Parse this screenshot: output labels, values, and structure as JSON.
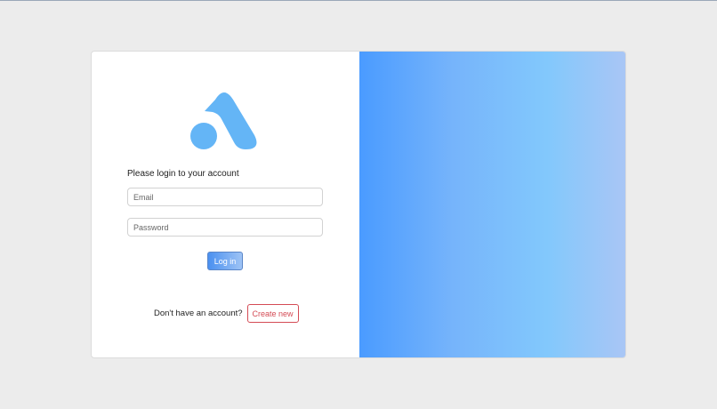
{
  "login": {
    "prompt": "Please login to your account",
    "email_placeholder": "Email",
    "password_placeholder": "Password",
    "login_label": "Log in",
    "signup_prompt": "Don't have an account?",
    "create_label": "Create new"
  },
  "colors": {
    "accent": "#64b5f6",
    "danger": "#d44b55",
    "background": "#ececec"
  },
  "icons": {
    "logo": "brand-logo-icon"
  }
}
